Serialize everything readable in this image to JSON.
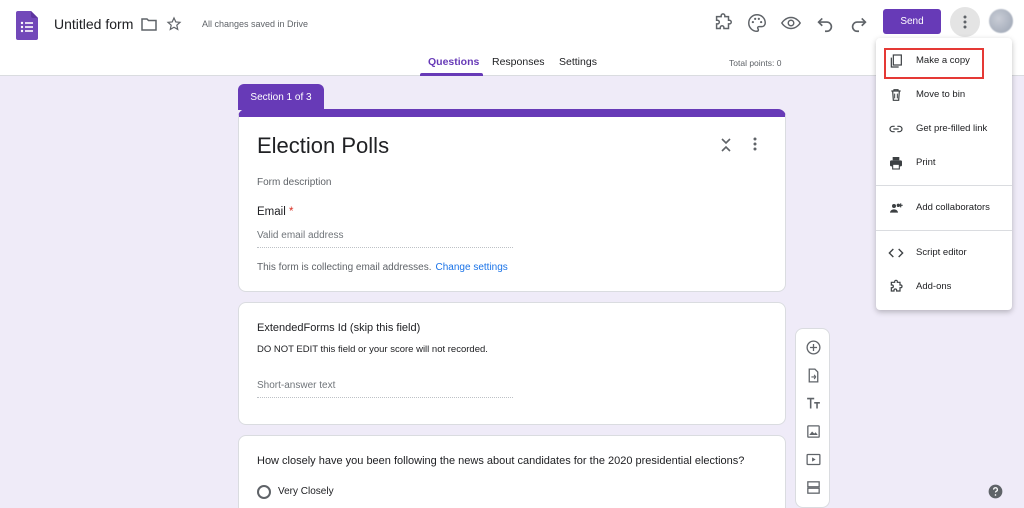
{
  "header": {
    "title": "Untitled form",
    "save_status": "All changes saved in Drive",
    "send_label": "Send"
  },
  "tabs": [
    {
      "label": "Questions",
      "active": true
    },
    {
      "label": "Responses",
      "active": false
    },
    {
      "label": "Settings",
      "active": false
    }
  ],
  "total_points": "Total points: 0",
  "section": {
    "label": "Section 1 of 3"
  },
  "form": {
    "title": "Election Polls",
    "description_placeholder": "Form description",
    "email_label": "Email",
    "required_mark": "*",
    "email_placeholder": "Valid email address",
    "collect_note": "This form is collecting email addresses.",
    "change_settings": "Change settings"
  },
  "questions": [
    {
      "title": "ExtendedForms Id (skip this field)",
      "description": "DO NOT EDIT this field or your score will not recorded.",
      "answer_placeholder": "Short-answer text"
    },
    {
      "title": "How closely have you been following the news about candidates for the 2020 presidential elections?",
      "options": [
        "Very Closely"
      ]
    }
  ],
  "menu": {
    "items": [
      {
        "label": "Make a copy",
        "icon": "copy-icon"
      },
      {
        "label": "Move to bin",
        "icon": "trash-icon"
      },
      {
        "label": "Get pre-filled link",
        "icon": "link-icon"
      },
      {
        "label": "Print",
        "icon": "print-icon"
      },
      {
        "label": "Add collaborators",
        "icon": "add-people-icon"
      },
      {
        "label": "Script editor",
        "icon": "code-icon"
      },
      {
        "label": "Add-ons",
        "icon": "puzzle-icon"
      }
    ]
  },
  "colors": {
    "accent": "#673ab7",
    "background": "#efebf8",
    "highlight": "#e53935",
    "link": "#1a73e8"
  }
}
